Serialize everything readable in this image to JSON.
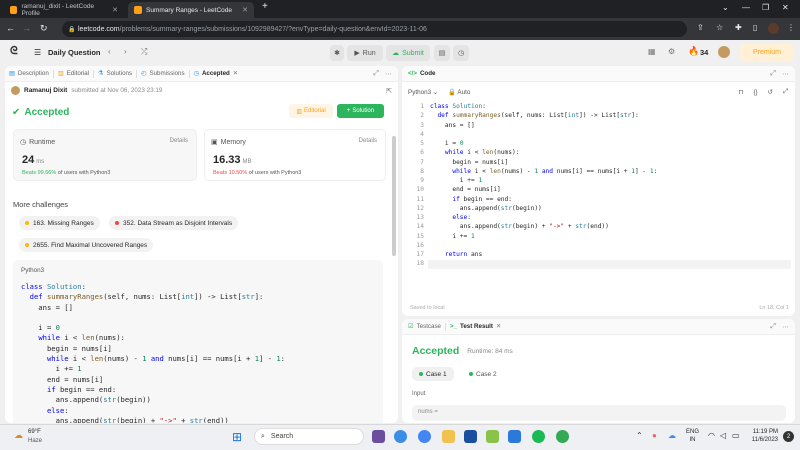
{
  "browser": {
    "tabs": [
      {
        "title": "ramanuj_dixit - LeetCode Profile",
        "active": false
      },
      {
        "title": "Summary Ranges - LeetCode",
        "active": true
      }
    ],
    "url_host": "leetcode.com",
    "url_path": "/problems/summary-ranges/submissions/1092989427/?envType=daily-question&envId=2023-11-06"
  },
  "nav": {
    "daily_label": "Daily Question",
    "run_label": "Run",
    "submit_label": "Submit",
    "streak": "34",
    "premium_label": "Premium"
  },
  "left": {
    "tabs": [
      "Description",
      "Editorial",
      "Solutions",
      "Submissions",
      "Accepted"
    ],
    "user": "Ramanuj Dixit",
    "submitted": "submitted at Nov 06, 2023 23:19",
    "status": "Accepted",
    "editorial_btn": "Editorial",
    "solution_btn": "Solution",
    "runtime": {
      "label": "Runtime",
      "details": "Details",
      "value": "24",
      "unit": "ms",
      "beats": "Beats 99.66%",
      "of": "of users with Python3"
    },
    "memory": {
      "label": "Memory",
      "details": "Details",
      "value": "16.33",
      "unit": "MB",
      "beats": "Beats 10.50%",
      "of": "of users with Python3"
    },
    "more_title": "More challenges",
    "challenges": [
      "163. Missing Ranges",
      "352. Data Stream as Disjoint Intervals",
      "2655. Find Maximal Uncovered Ranges"
    ],
    "code_lang": "Python3"
  },
  "editor": {
    "tab": "Code",
    "lang": "Python3",
    "mode": "Auto",
    "saved": "Saved to local",
    "cursor": "Ln 18, Col 1"
  },
  "bottom": {
    "tabs": [
      "Testcase",
      "Test Result"
    ],
    "status": "Accepted",
    "runtime": "Runtime: 84 ms",
    "cases": [
      "Case 1",
      "Case 2"
    ],
    "input_label": "Input",
    "input_value": "nums ="
  },
  "taskbar": {
    "temp": "69°F",
    "weather": "Haze",
    "search": "Search",
    "lang": "ENG",
    "region": "IN",
    "time": "11:19 PM",
    "date": "11/6/2023",
    "badge": "2"
  },
  "colors": {
    "accepted": "#2db55d",
    "orange": "#ffa116",
    "red": "#ef4743",
    "link": "#1a90ff"
  }
}
